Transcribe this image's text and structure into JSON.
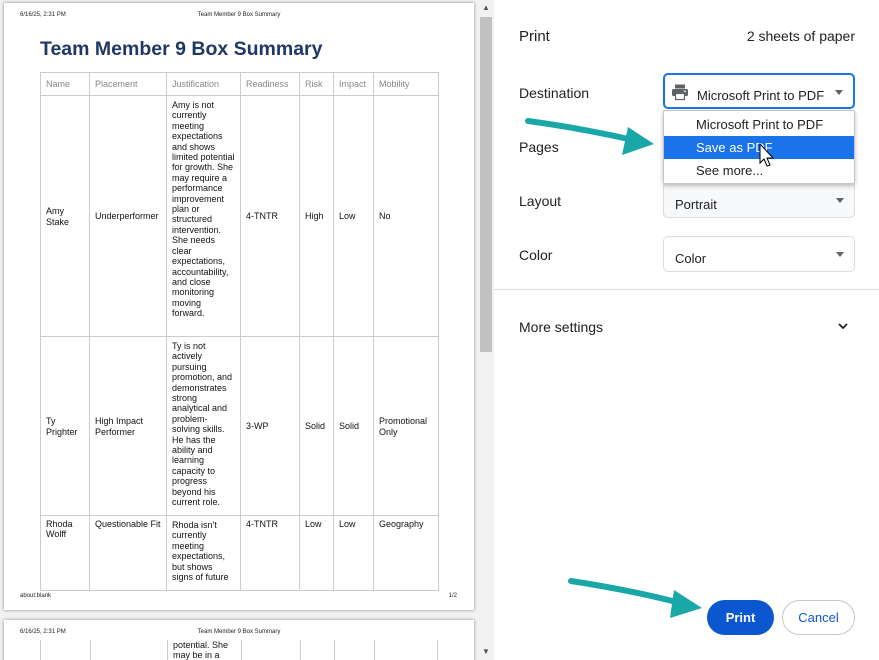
{
  "preview": {
    "header_left": "6/16/25, 2:31 PM",
    "header_center": "Team Member 9 Box Summary",
    "title": "Team Member 9 Box Summary",
    "footer_left": "about:blank",
    "footer_right": "1/2",
    "columns": [
      "Name",
      "Placement",
      "Justification",
      "Readiness",
      "Risk",
      "Impact",
      "Mobility"
    ],
    "rows": [
      {
        "name": "Amy Stake",
        "placement": "Underperformer",
        "justification": "Amy is not currently meeting expectations and shows limited potential for growth. She may require a performance improvement plan or structured intervention. She needs clear expectations, accountability, and close monitoring moving forward.",
        "readiness": "4-TNTR",
        "risk": "High",
        "impact": "Low",
        "mobility": "No"
      },
      {
        "name": "Ty Prighter",
        "placement": "High Impact Performer",
        "justification": "Ty is not actively pursuing promotion, and demonstrates strong analytical and problem-solving skills. He has the ability and learning capacity to progress beyond his current role.",
        "readiness": "3-WP",
        "risk": "Solid",
        "impact": "Solid",
        "mobility": "Promotional Only"
      },
      {
        "name": "Rhoda Wolff",
        "placement": "Questionable Fit",
        "justification": "Rhoda isn't currently meeting expectations, but shows signs of future",
        "readiness": "4-TNTR",
        "risk": "Low",
        "impact": "Low",
        "mobility": "Geography"
      }
    ],
    "page2_header_left": "6/16/25, 2:31 PM",
    "page2_header_center": "Team Member 9 Box Summary",
    "page2_continuation": "potential. She\nmay be in a"
  },
  "settings": {
    "title": "Print",
    "sheets": "2 sheets of paper",
    "destination_label": "Destination",
    "destination_value": "Microsoft Print to PDF",
    "dropdown_options": [
      "Microsoft Print to PDF",
      "Save as PDF",
      "See more..."
    ],
    "pages_label": "Pages",
    "layout_label": "Layout",
    "layout_value": "Portrait",
    "color_label": "Color",
    "color_value": "Color",
    "more_settings": "More settings",
    "print_button": "Print",
    "cancel_button": "Cancel"
  },
  "colors": {
    "accent": "#1a73e8",
    "print_button": "#0b57d0",
    "title": "#1f3864",
    "annotation_arrow": "#1aa7a8"
  },
  "icons": [
    "printer-icon",
    "chevron-down-icon",
    "caret-down-icon",
    "mouse-cursor-icon",
    "annotation-arrow-icon"
  ]
}
